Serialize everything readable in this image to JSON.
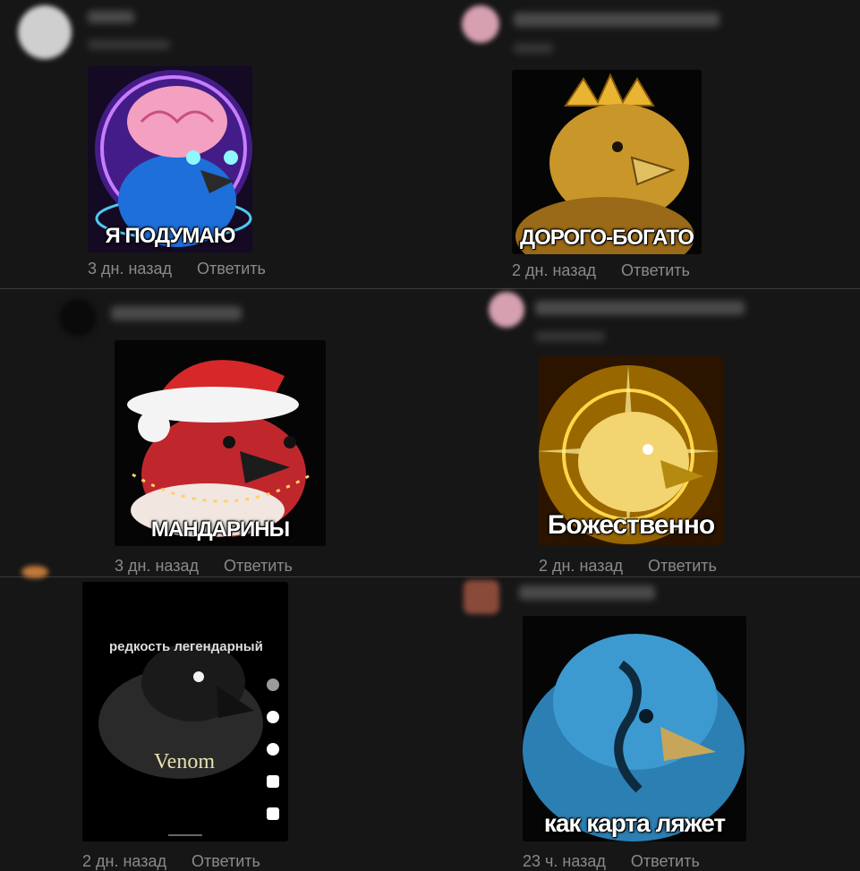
{
  "comments": [
    {
      "sticker": {
        "caption": "Я ПОДУМАЮ",
        "subject": "bird-with-glowing-brain"
      },
      "time": "3 дн. назад",
      "reply": "Ответить"
    },
    {
      "sticker": {
        "caption": "ДОРОГО-БОГАТО",
        "subject": "golden-bird-with-crown"
      },
      "time": "2 дн. назад",
      "reply": "Ответить"
    },
    {
      "sticker": {
        "caption": "МАНДАРИНЫ",
        "subject": "bird-in-santa-hat"
      },
      "time": "3 дн. назад",
      "reply": "Ответить"
    },
    {
      "sticker": {
        "caption": "Божественно",
        "subject": "radiant-golden-bird"
      },
      "time": "2 дн. назад",
      "reply": "Ответить"
    },
    {
      "sticker": {
        "caption": "Venom",
        "overlay_text": "редкость легендарный",
        "subject": "black-bird-video"
      },
      "time": "2 дн. назад",
      "reply": "Ответить"
    },
    {
      "sticker": {
        "caption": "как карта ляжет",
        "subject": "blue-bird-with-tattoo"
      },
      "time": "23 ч. назад",
      "reply": "Ответить"
    }
  ],
  "colors": {
    "background": "#161616",
    "meta_text": "#8a8a8a",
    "divider": "#3a3a3a"
  }
}
